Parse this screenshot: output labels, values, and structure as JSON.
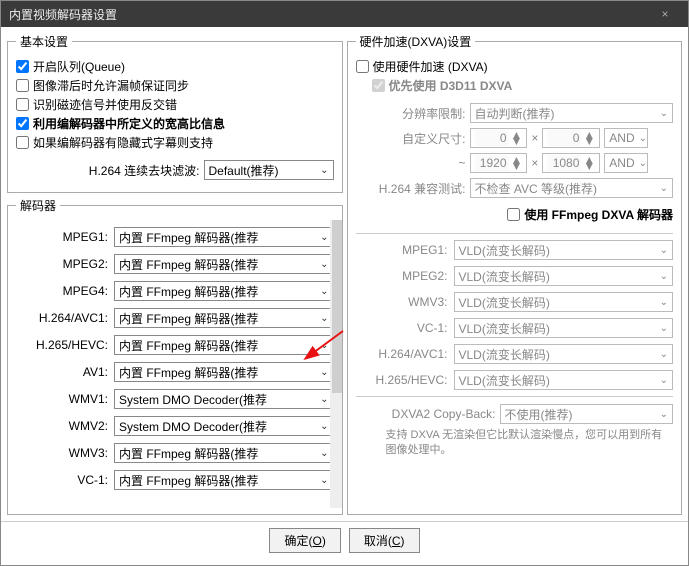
{
  "title": "内置视频解码器设置",
  "basic": {
    "legend": "基本设置",
    "cb_queue": "开启队列(Queue)",
    "cb_lag": "图像滞后时允许漏帧保证同步",
    "cb_mag": "识别磁迹信号并使用反交错",
    "cb_aspect": "利用编解码器中所定义的宽高比信息",
    "cb_sub": "如果编解码器有隐藏式字幕则支持",
    "h264_label": "H.264 连续去块滤波:",
    "h264_value": "Default(推荐)"
  },
  "decoders": {
    "legend": "解码器",
    "items": [
      {
        "name": "MPEG1:",
        "value": "内置 FFmpeg 解码器(推荐"
      },
      {
        "name": "MPEG2:",
        "value": "内置 FFmpeg 解码器(推荐"
      },
      {
        "name": "MPEG4:",
        "value": "内置 FFmpeg 解码器(推荐"
      },
      {
        "name": "H.264/AVC1:",
        "value": "内置 FFmpeg 解码器(推荐"
      },
      {
        "name": "H.265/HEVC:",
        "value": "内置 FFmpeg 解码器(推荐"
      },
      {
        "name": "AV1:",
        "value": "内置 FFmpeg 解码器(推荐"
      },
      {
        "name": "WMV1:",
        "value": "System DMO Decoder(推荐"
      },
      {
        "name": "WMV2:",
        "value": "System DMO Decoder(推荐"
      },
      {
        "name": "WMV3:",
        "value": "内置 FFmpeg 解码器(推荐"
      },
      {
        "name": "VC-1:",
        "value": "内置 FFmpeg 解码器(推荐"
      }
    ]
  },
  "dxva": {
    "legend": "硬件加速(DXVA)设置",
    "cb_hw": "使用硬件加速 (DXVA)",
    "cb_d3d11": "优先使用 D3D11 DXVA",
    "res_label": "分辨率限制:",
    "res_value": "自动判断(推荐)",
    "custom_label": "自定义尺寸:",
    "w1": "0",
    "h1": "0",
    "op1": "AND",
    "w2": "1920",
    "h2": "1080",
    "op2": "AND",
    "compat_label": "H.264 兼容测试:",
    "compat_value": "不检查 AVC 等级(推荐)",
    "cb_ffmpeg": "使用 FFmpeg DXVA 解码器",
    "list": [
      {
        "name": "MPEG1:",
        "value": "VLD(流变长解码)"
      },
      {
        "name": "MPEG2:",
        "value": "VLD(流变长解码)"
      },
      {
        "name": "WMV3:",
        "value": "VLD(流变长解码)"
      },
      {
        "name": "VC-1:",
        "value": "VLD(流变长解码)"
      },
      {
        "name": "H.264/AVC1:",
        "value": "VLD(流变长解码)"
      },
      {
        "name": "H.265/HEVC:",
        "value": "VLD(流变长解码)"
      }
    ],
    "copyback_label": "DXVA2 Copy-Back:",
    "copyback_value": "不使用(推荐)",
    "hint": "支持 DXVA 无渲染但它比默认渲染慢点，您可以用到所有图像处理中。"
  },
  "footer": {
    "ok": "确定",
    "ok_key": "O",
    "cancel": "取消",
    "cancel_key": "C"
  },
  "glyph_x": "×",
  "glyph_tilde": "~"
}
